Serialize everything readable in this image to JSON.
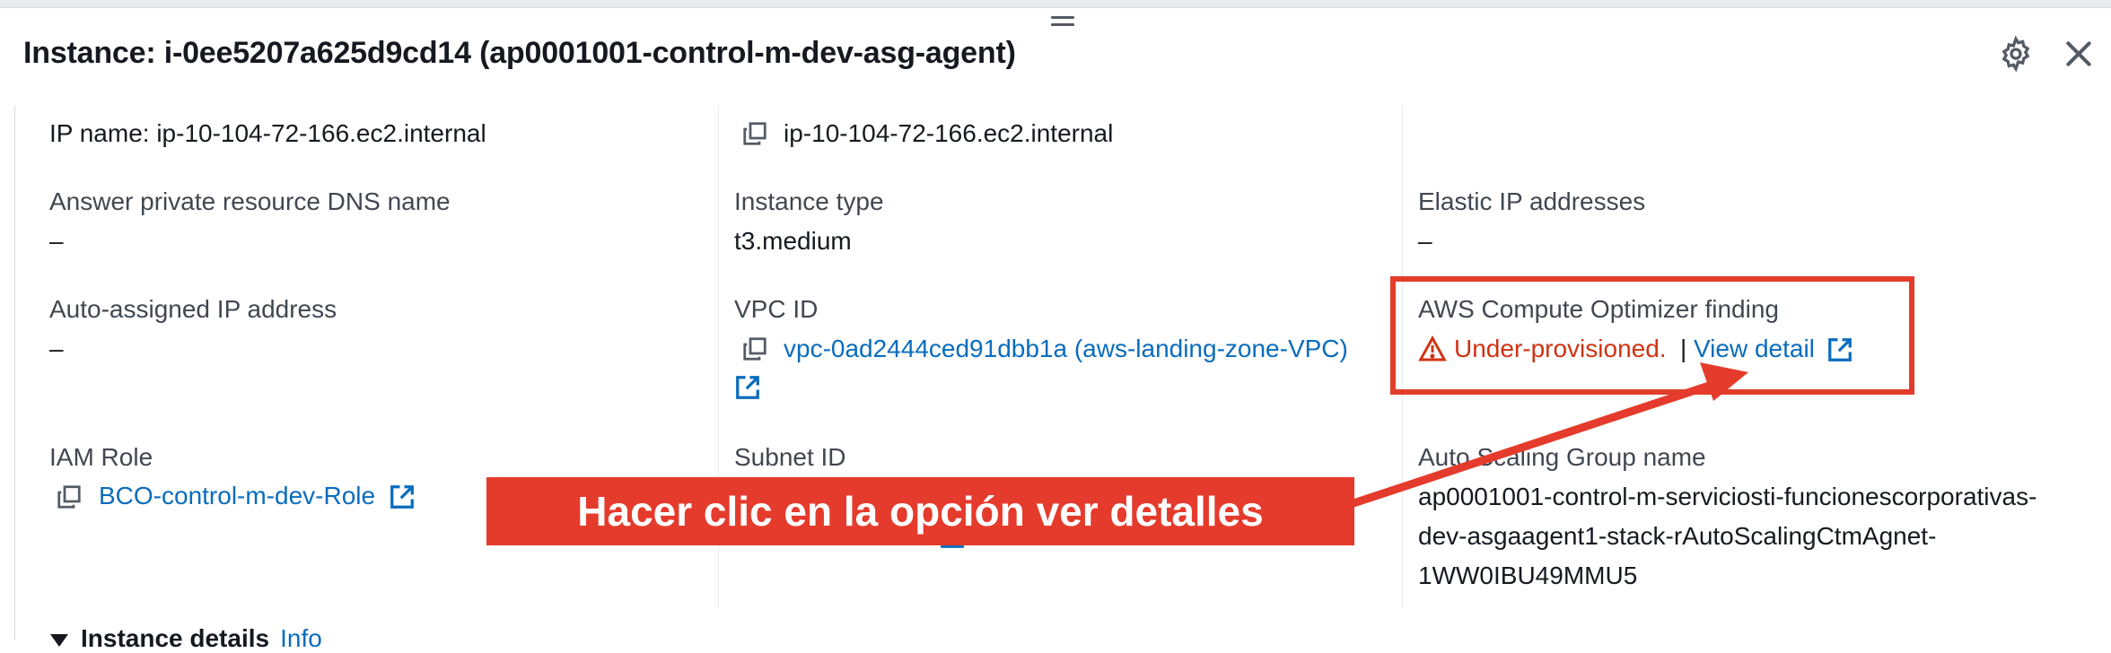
{
  "header": {
    "title": "Instance: i-0ee5207a625d9cd14 (ap0001001-control-m-dev-asg-agent)",
    "settings_icon": "gear-icon",
    "close_icon": "close-icon"
  },
  "col1": {
    "ip_name": "IP name: ip-10-104-72-166.ec2.internal",
    "answer_dns_label": "Answer private resource DNS name",
    "answer_dns_value": "–",
    "auto_ip_label": "Auto-assigned IP address",
    "auto_ip_value": "–",
    "iam_label": "IAM Role",
    "iam_value": "BCO-control-m-dev-Role"
  },
  "col2": {
    "private_dns": "ip-10-104-72-166.ec2.internal",
    "instance_type_label": "Instance type",
    "instance_type_value": "t3.medium",
    "vpc_label": "VPC ID",
    "vpc_value": "vpc-0ad2444ced91dbb1a (aws-landing-zone-VPC)",
    "subnet_label": "Subnet ID"
  },
  "col3": {
    "elastic_label": "Elastic IP addresses",
    "elastic_value": "–",
    "optimizer_label": "AWS Compute Optimizer finding",
    "optimizer_finding": "Under-provisioned.",
    "separator": "|",
    "view_detail": "View detail",
    "asg_label": "Auto Scaling Group name",
    "asg_line1": "ap0001001-control-m-serviciosti-funcionescorporativas-",
    "asg_line2": "dev-asgaagent1-stack-rAutoScalingCtmAgnet-",
    "asg_line3": "1WW0IBU49MMU5"
  },
  "annotation": {
    "callout_text": "Hacer clic en la opción ver detalles",
    "accent_color": "#e53b2c"
  },
  "section": {
    "title": "Instance details",
    "info": "Info"
  },
  "colors": {
    "link": "#0a6cbd",
    "warning": "#d13212"
  }
}
